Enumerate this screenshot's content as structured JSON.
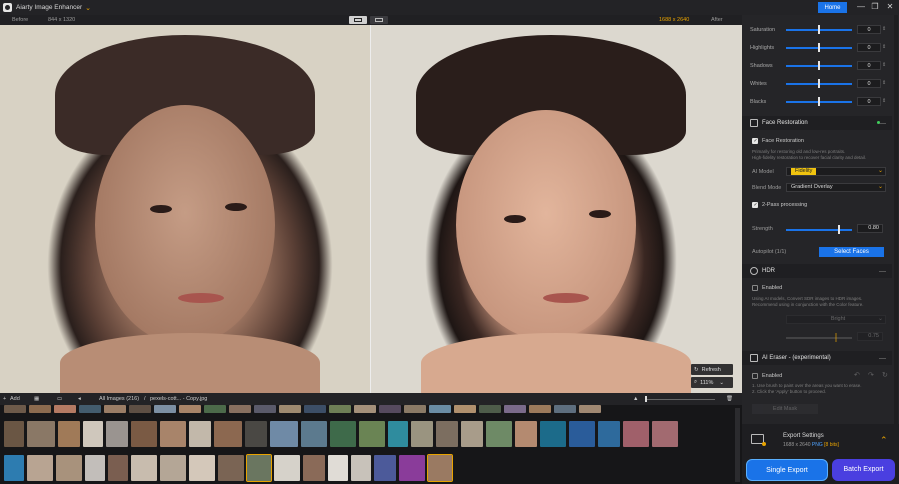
{
  "app": {
    "title": "Aiarty Image Enhancer",
    "home_label": "Home",
    "win_minimize": "—",
    "win_restore": "❐",
    "win_close": "✕"
  },
  "viewer": {
    "before_label": "Before",
    "before_size": "844 x 1320",
    "after_size": "1688 x 2640",
    "after_label": "After",
    "refresh_label": "Refresh",
    "zoom_value": "111%"
  },
  "adjustments": {
    "sliders": [
      {
        "label": "Saturation",
        "value": "0"
      },
      {
        "label": "Highlights",
        "value": "0"
      },
      {
        "label": "Shadows",
        "value": "0"
      },
      {
        "label": "Whites",
        "value": "0"
      },
      {
        "label": "Blacks",
        "value": "0"
      }
    ]
  },
  "face_restoration": {
    "header": "Face Restoration",
    "checkbox_label": "Face Restoration",
    "desc_line1": "Primarily for restoring old and low-res portraits.",
    "desc_line2": "High-fidelity restoration to recover facial clarity and detail.",
    "ai_model_label": "AI Model",
    "ai_model_value": "Fidelity",
    "blend_mode_label": "Blend Mode",
    "blend_mode_value": "Gradient Overlay",
    "two_pass_label": "2-Pass processing",
    "strength_label": "Strength",
    "strength_value": "0.80",
    "strength_level": 0.8,
    "autopilot_label": "Autopilot (1/1)",
    "select_faces_label": "Select Faces"
  },
  "hdr": {
    "header": "HDR",
    "enabled_label": "Enabled",
    "desc_line1": "Using AI models, Convert SDR images to HDR images.",
    "desc_line2": "Recommend using in conjunction with the Color feature.",
    "mode_value": "Bright",
    "strength_value": "0.75"
  },
  "ai_eraser": {
    "header": "AI Eraser - (experimental)",
    "enabled_label": "Enabled",
    "step1": "1. Use brush to paint over the areas you want to erase.",
    "step2": "2. Click the 'Apply' button to proceed.",
    "edit_mask_label": "Edit Mask"
  },
  "export": {
    "title": "Export Settings",
    "size": "1688 x 2640",
    "format": "PNG",
    "bits": "[8 bits]",
    "single_label": "Single Export",
    "batch_label": "Batch Export"
  },
  "filmstrip": {
    "add_label": "Add",
    "breadcrumb": "All Images (216)",
    "separator": "/",
    "current_file": "pexels-cott... - Copy.jpg"
  },
  "colors": {
    "accent": "#1a73e8",
    "highlight": "#e8a300",
    "batch": "#4a3fe0"
  }
}
